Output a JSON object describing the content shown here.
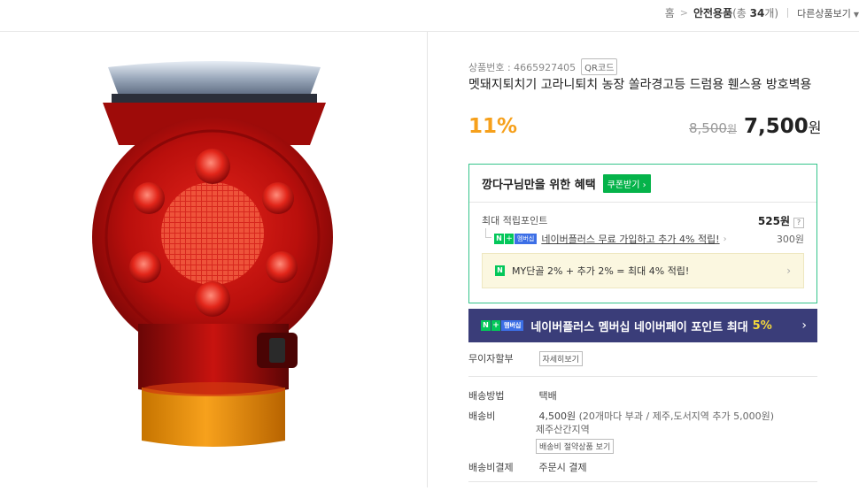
{
  "breadcrumb": {
    "home": "홈",
    "separator": ">",
    "category": "안전용품",
    "count_prefix": "(총 ",
    "count": "34",
    "count_suffix": "개)",
    "other_products": "다른상품보기"
  },
  "product": {
    "number_label": "상품번호 : 4665927405",
    "qr_label": "QR코드",
    "title": "멧돼지퇴치기 고라니퇴치 농장 쏠라경고등 드럼용 휀스용 방호벽용",
    "discount": "11%",
    "original_price": "8,500",
    "original_unit": "원",
    "price": "7,500",
    "price_unit": "원"
  },
  "benefit": {
    "heading": "깡다구님만을 위한 혜택",
    "coupon_button": "쿠폰받기",
    "max_points_label": "최대 적립포인트",
    "max_points_value": "525원",
    "help": "?",
    "naver_plus_text": "네이버플러스 무료 가입하고 추가 4% 적립!",
    "naver_plus_value": "300원",
    "my_grade_text": "MY단골 2% + 추가 2% = 최대 4% 적립!"
  },
  "naverpay_bar": {
    "text": "네이버플러스 멤버십 네이버페이 포인트 최대",
    "percent": "5%"
  },
  "badge": {
    "n": "N",
    "plus": "+",
    "membership": "멤버십"
  },
  "installment": {
    "label": "무이자할부",
    "detail_button": "자세히보기"
  },
  "shipping": {
    "method_label": "배송방법",
    "method_value": "택배",
    "fee_label": "배송비",
    "fee_value": "4,500원",
    "fee_detail": "(20개마다 부과 / 제주,도서지역 추가 5,000원)",
    "region": "제주산간지역",
    "fee_button": "배송비 절약상품 보기",
    "payment_label": "배송비결제",
    "payment_value": "주문시 결제"
  },
  "colors": {
    "discount": "#f6a01b",
    "naver_green": "#03c75a",
    "naverpay_bar": "#3a3d79"
  }
}
